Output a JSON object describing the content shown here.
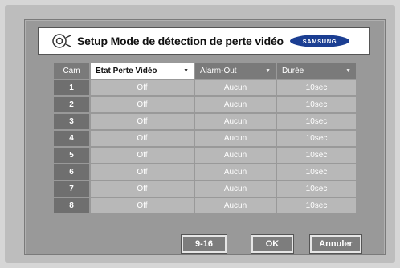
{
  "dialog": {
    "title": "Setup Mode de détection de perte vidéo",
    "brand": "SAMSUNG"
  },
  "table": {
    "headers": [
      "Cam",
      "Etat Perte Vidéo",
      "Alarm-Out",
      "Durée"
    ],
    "rows": [
      [
        "1",
        "Off",
        "Aucun",
        "10sec"
      ],
      [
        "2",
        "Off",
        "Aucun",
        "10sec"
      ],
      [
        "3",
        "Off",
        "Aucun",
        "10sec"
      ],
      [
        "4",
        "Off",
        "Aucun",
        "10sec"
      ],
      [
        "5",
        "Off",
        "Aucun",
        "10sec"
      ],
      [
        "6",
        "Off",
        "Aucun",
        "10sec"
      ],
      [
        "7",
        "Off",
        "Aucun",
        "10sec"
      ],
      [
        "8",
        "Off",
        "Aucun",
        "10sec"
      ]
    ]
  },
  "buttons": {
    "range": "9-16",
    "ok": "OK",
    "cancel": "Annuler"
  },
  "colors": {
    "panel": "#999999",
    "header_cell": "#7a7a7a",
    "value_cell": "#b8b8b8",
    "brand_blue": "#1b3e92"
  }
}
